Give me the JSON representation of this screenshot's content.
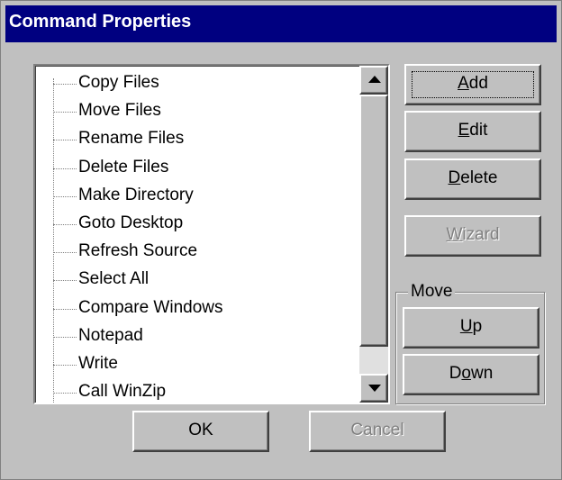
{
  "window": {
    "title": "Command Properties"
  },
  "commands": {
    "items": [
      "Copy Files",
      "Move Files",
      "Rename Files",
      "Delete Files",
      "Make Directory",
      "Goto Desktop",
      "Refresh Source",
      "Select All",
      "Compare Windows",
      "Notepad",
      "Write",
      "Call WinZip"
    ]
  },
  "buttons": {
    "add": {
      "pre": "",
      "accel": "A",
      "post": "dd",
      "enabled": true,
      "focused": true
    },
    "edit": {
      "pre": "",
      "accel": "E",
      "post": "dit",
      "enabled": true
    },
    "delete": {
      "pre": "",
      "accel": "D",
      "post": "elete",
      "enabled": true
    },
    "wizard": {
      "pre": "",
      "accel": "W",
      "post": "izard",
      "enabled": false
    },
    "up": {
      "pre": "",
      "accel": "U",
      "post": "p",
      "enabled": true
    },
    "down": {
      "pre": "D",
      "accel": "o",
      "post": "wn",
      "enabled": true
    },
    "ok": "OK",
    "cancel": "Cancel"
  },
  "move_group": {
    "label": "Move"
  },
  "colors": {
    "face": "#c0c0c0",
    "titlebar": "#000080",
    "title_text": "#ffffff"
  }
}
